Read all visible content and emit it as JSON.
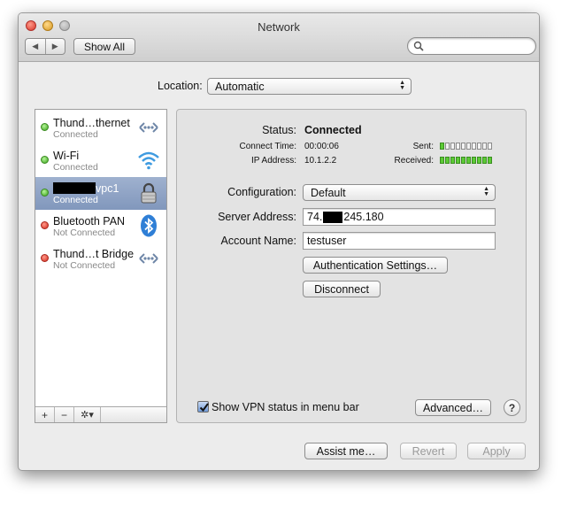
{
  "window": {
    "title": "Network"
  },
  "toolbar": {
    "back": "◀",
    "forward": "▶",
    "show_all": "Show All",
    "search_placeholder": ""
  },
  "location": {
    "label": "Location:",
    "value": "Automatic"
  },
  "services": [
    {
      "name": "Thund…thernet",
      "status": "Connected",
      "state": "green",
      "icon": "ethernet-icon"
    },
    {
      "name": "Wi-Fi",
      "status": "Connected",
      "state": "green",
      "icon": "wifi-icon"
    },
    {
      "name": "vpc1",
      "status": "Connected",
      "state": "green",
      "icon": "lock-icon",
      "selected": true
    },
    {
      "name": "Bluetooth PAN",
      "status": "Not Connected",
      "state": "red",
      "icon": "bluetooth-icon"
    },
    {
      "name": "Thund…t Bridge",
      "status": "Not Connected",
      "state": "red",
      "icon": "ethernet-icon"
    }
  ],
  "sidebar_toolbar": {
    "add": "+",
    "remove": "−",
    "gear": "✲▾"
  },
  "detail": {
    "status_label": "Status:",
    "status_value": "Connected",
    "connect_time_label": "Connect Time:",
    "connect_time_value": "00:00:06",
    "ip_label": "IP Address:",
    "ip_value": "10.1.2.2",
    "sent_label": "Sent:",
    "received_label": "Received:",
    "sent_level": 0.1,
    "received_level": 1.0,
    "configuration_label": "Configuration:",
    "configuration_value": "Default",
    "server_label": "Server Address:",
    "server_prefix": "74.",
    "server_suffix": "245.180",
    "account_label": "Account Name:",
    "account_value": "testuser",
    "auth_button": "Authentication Settings…",
    "disconnect_button": "Disconnect",
    "show_vpn_label": "Show VPN status in menu bar",
    "show_vpn_checked": true,
    "advanced_button": "Advanced…",
    "help": "?"
  },
  "footer": {
    "assist": "Assist me…",
    "revert": "Revert",
    "apply": "Apply"
  },
  "colors": {
    "selection": "#8fa3c6",
    "meter_on": "#5ccb35",
    "connected": "#3aa31b",
    "disconnected": "#d32a1e"
  }
}
